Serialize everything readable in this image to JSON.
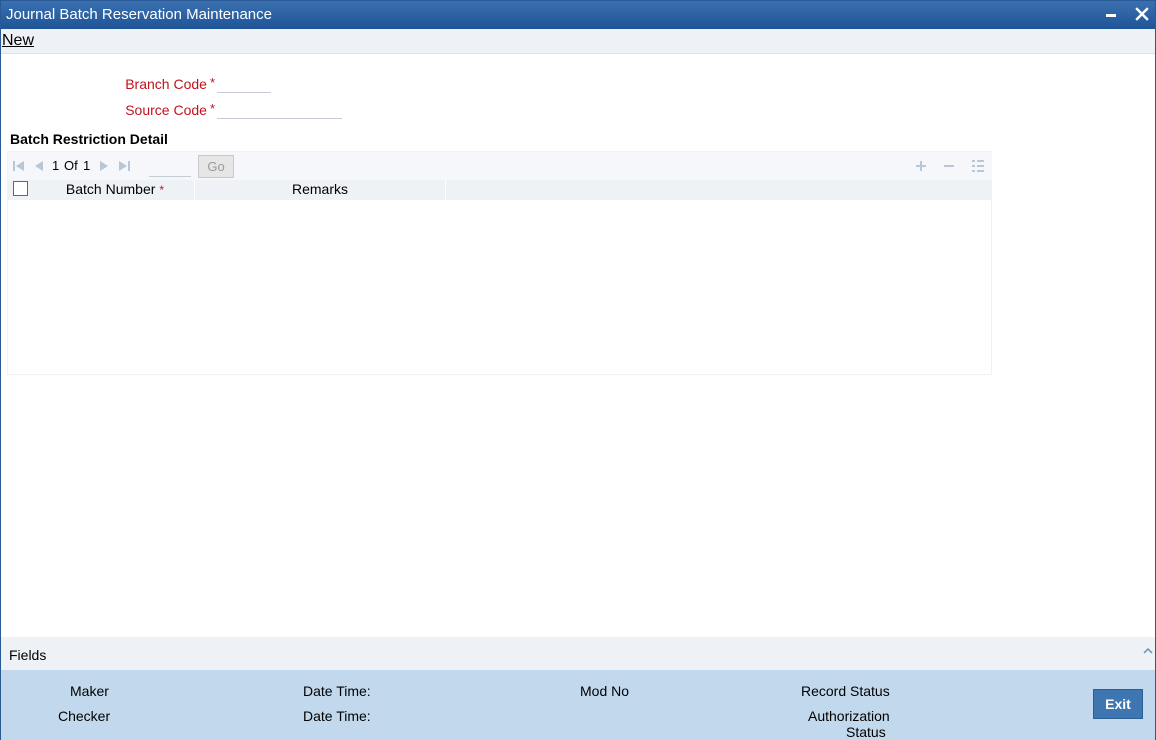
{
  "window": {
    "title": "Journal Batch Reservation Maintenance",
    "minimize_icon": "minimize-icon",
    "close_icon": "close-icon"
  },
  "menu": {
    "new_label": "New"
  },
  "form": {
    "branch_code_label": "Branch Code",
    "branch_code_value": "",
    "source_code_label": "Source Code",
    "source_code_value": "",
    "required_marker": "*"
  },
  "batch_section": {
    "title": "Batch Restriction Detail",
    "pagination": {
      "current_page": "1",
      "of_label": "Of",
      "total_pages": "1",
      "go_label": "Go",
      "page_input_value": ""
    },
    "columns": [
      {
        "label": "Batch Number",
        "required": "*"
      },
      {
        "label": "Remarks"
      }
    ],
    "rows": []
  },
  "footer": {
    "fields_label": "Fields",
    "maker_label": "Maker",
    "checker_label": "Checker",
    "date_time_label": "Date Time:",
    "mod_no_label": "Mod No",
    "record_status_label": "Record Status",
    "authorization_label": "Authorization",
    "status_label": "Status",
    "exit_label": "Exit"
  },
  "colors": {
    "title_bar": "#1f5596",
    "required_text": "#c0141e",
    "audit_bar": "#c2d9ed",
    "exit_button": "#3d76b0"
  }
}
